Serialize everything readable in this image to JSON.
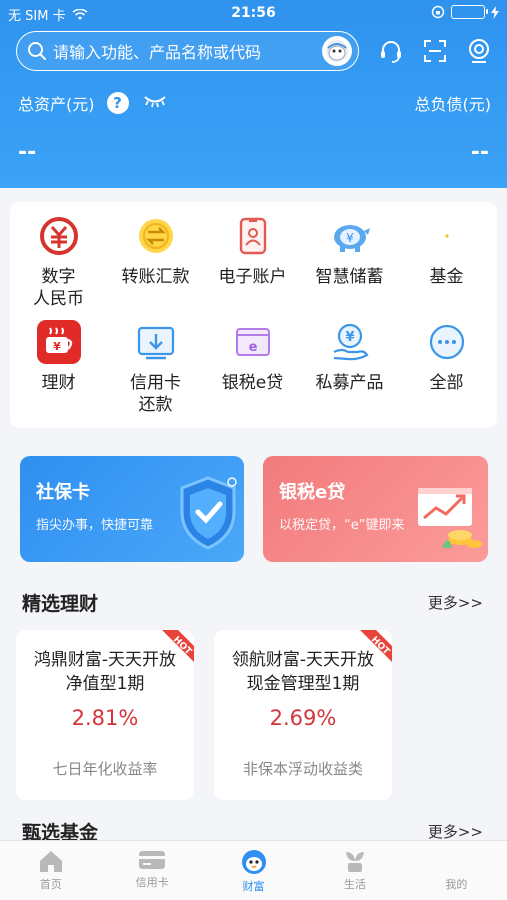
{
  "status": {
    "carrier": "无 SIM 卡",
    "time": "21:56"
  },
  "search": {
    "placeholder": "请输入功能、产品名称或代码"
  },
  "assets": {
    "total_assets_label": "总资产(元)",
    "total_liabilities_label": "总负债(元)",
    "total_assets_value": "--",
    "total_liabilities_value": "--",
    "help": "?"
  },
  "functions": [
    {
      "label": "数字\n人民币",
      "icon": "digital-rmb-icon"
    },
    {
      "label": "转账汇款",
      "icon": "transfer-icon"
    },
    {
      "label": "电子账户",
      "icon": "e-account-icon"
    },
    {
      "label": "智慧储蓄",
      "icon": "piggy-bank-icon"
    },
    {
      "label": "基金",
      "icon": "fund-icon"
    },
    {
      "label": "理财",
      "icon": "wealth-cup-icon"
    },
    {
      "label": "信用卡\n还款",
      "icon": "credit-repay-icon"
    },
    {
      "label": "银税e贷",
      "icon": "tax-loan-icon"
    },
    {
      "label": "私募产品",
      "icon": "private-fund-icon"
    },
    {
      "label": "全部",
      "icon": "more-dots-icon"
    }
  ],
  "promos": [
    {
      "title": "社保卡",
      "subtitle": "指尖办事，快捷可靠"
    },
    {
      "title": "银税e贷",
      "subtitle": "以税定贷，“e”键即来"
    }
  ],
  "featured_wealth": {
    "title": "精选理财",
    "more": "更多>>",
    "products": [
      {
        "name": "鸿鼎财富-天天开放\n净值型1期",
        "rate": "2.81%",
        "desc": "七日年化收益率",
        "badge": "HOT"
      },
      {
        "name": "领航财富-天天开放\n现金管理型1期",
        "rate": "2.69%",
        "desc": "非保本浮动收益类",
        "badge": "HOT"
      }
    ]
  },
  "featured_funds": {
    "title": "甄选基金",
    "more": "更多>>"
  },
  "tabs": [
    {
      "label": "首页",
      "icon": "home-icon",
      "active": false
    },
    {
      "label": "信用卡",
      "icon": "credit-card-icon",
      "active": false
    },
    {
      "label": "财富",
      "icon": "wealth-mascot-icon",
      "active": true
    },
    {
      "label": "生活",
      "icon": "life-plant-icon",
      "active": false
    },
    {
      "label": "我的",
      "icon": "profile-icon",
      "active": false
    }
  ],
  "colors": {
    "primary": "#2f93ee",
    "rate_red": "#d4343b",
    "promo_red": "#f27a7c"
  }
}
